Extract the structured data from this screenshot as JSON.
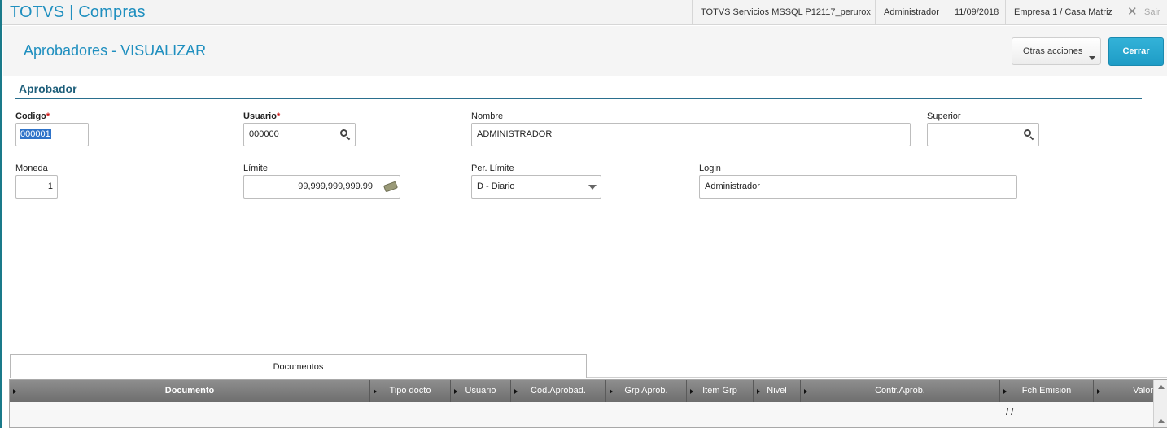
{
  "app": {
    "title": "TOTVS | Compras"
  },
  "topbar": {
    "server": "TOTVS Servicios MSSQL P12117_perurox",
    "user": "Administrador",
    "date": "11/09/2018",
    "company": "Empresa 1 / Casa Matriz",
    "exit_label": "Sair",
    "close_icon": "✕"
  },
  "header": {
    "title": "Aprobadores - VISUALIZAR",
    "other_actions_label": "Otras acciones",
    "close_label": "Cerrar"
  },
  "section": {
    "title": "Aprobador"
  },
  "form": {
    "codigo": {
      "label": "Codigo",
      "required": "*",
      "value": "000001"
    },
    "usuario": {
      "label": "Usuario",
      "required": "*",
      "value": "000000"
    },
    "nombre": {
      "label": "Nombre",
      "value": "ADMINISTRADOR"
    },
    "superior": {
      "label": "Superior",
      "value": ""
    },
    "moneda": {
      "label": "Moneda",
      "value": "1"
    },
    "limite": {
      "label": "Límite",
      "value": "99,999,999,999.99"
    },
    "per_limite": {
      "label": "Per. Límite",
      "value": "D - Diario"
    },
    "login": {
      "label": "Login",
      "value": "Administrador"
    }
  },
  "tabs": [
    {
      "label": "Documentos"
    }
  ],
  "grid": {
    "columns": [
      "Documento",
      "Tipo docto",
      "Usuario",
      "Cod.Aprobad.",
      "Grp Aprob.",
      "Item Grp",
      "Nivel",
      "Contr.Aprob.",
      "Fch Emision",
      "Valor"
    ],
    "rows": [
      {
        "fch_emision": "/ /"
      }
    ]
  }
}
